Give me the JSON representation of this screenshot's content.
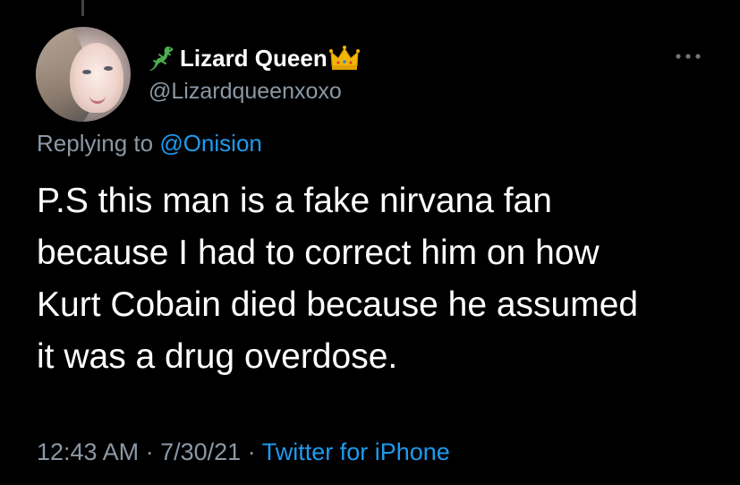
{
  "tweet": {
    "display_name": "Lizard Queen",
    "handle": "@Lizardqueenxoxo",
    "replying_prefix": "Replying to ",
    "replying_to": "@Onision",
    "body_lines": [
      "P.S this man is a fake nirvana fan",
      "because I had to correct him on how",
      "Kurt Cobain died because he assumed",
      "it was a drug overdose."
    ],
    "time": "12:43 AM",
    "separator_1": " · ",
    "date": "7/30/21",
    "separator_2": " · ",
    "source": "Twitter for iPhone"
  },
  "icons": {
    "name_prefix": "lizard-icon",
    "name_suffix": "crown-icon",
    "menu": "more-options-icon"
  },
  "colors": {
    "background": "#000000",
    "text": "#ffffff",
    "secondary_text": "#8b98a5",
    "link": "#1d9bf0"
  }
}
